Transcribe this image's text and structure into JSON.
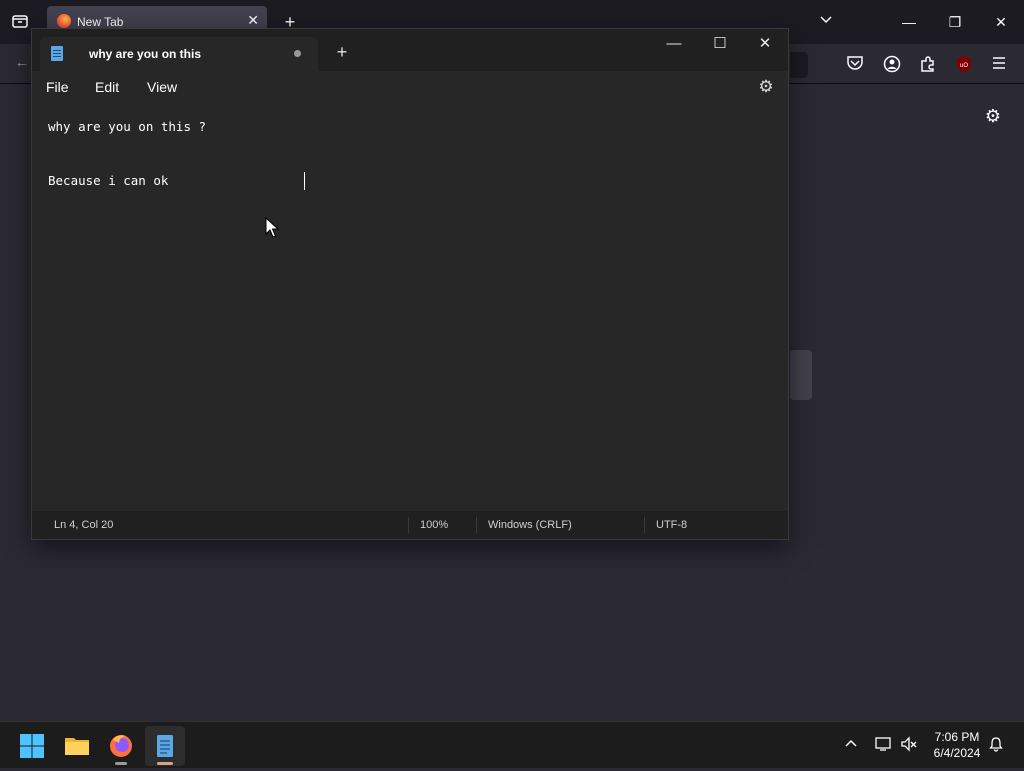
{
  "browser": {
    "tab_title": "New Tab",
    "tab_close_glyph": "✕",
    "new_tab_glyph": "+",
    "tabs_overview_icon": "tab-overview-icon",
    "list_all_tabs_glyph": "⌄",
    "minimize_glyph": "—",
    "restore_glyph": "❐",
    "close_glyph": "✕",
    "back_glyph": "←",
    "toolbar_icons": [
      "pocket-icon",
      "account-icon",
      "extensions-icon",
      "ublock-icon",
      "menu-icon"
    ],
    "settings_glyph": "⚙"
  },
  "notepad": {
    "tab_title": "why are you on this",
    "unsaved_indicator": "dot",
    "new_tab_glyph": "+",
    "controls": {
      "minimize": "—",
      "maximize": "☐",
      "close": "✕"
    },
    "menu": {
      "file": "File",
      "edit": "Edit",
      "view": "View"
    },
    "settings_glyph": "⚙",
    "content": {
      "line1": "why are you on this ?",
      "line2": "",
      "line3": "Because i can ok"
    },
    "status": {
      "position": "Ln 4, Col 20",
      "zoom": "100%",
      "line_ending": "Windows (CRLF)",
      "encoding": "UTF-8"
    }
  },
  "taskbar": {
    "apps": [
      "start-button",
      "file-explorer",
      "firefox",
      "notepad"
    ],
    "tray": {
      "chevron": "⌃",
      "time": "7:06 PM",
      "date": "6/4/2024"
    }
  },
  "colors": {
    "firefox_bg": "#2b2a33",
    "notepad_bg": "#272727",
    "taskbar_bg": "#1c1c1c",
    "ublock_red": "#800000"
  }
}
